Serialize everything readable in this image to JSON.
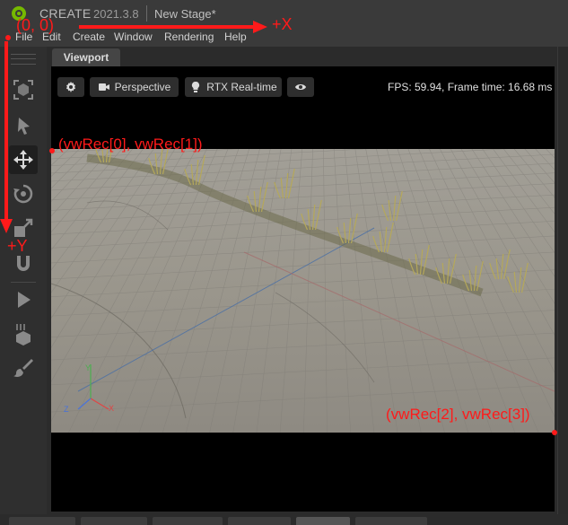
{
  "titlebar": {
    "app_name": "CREATE",
    "version": "2021.3.8",
    "stage": "New Stage*"
  },
  "menu": [
    "File",
    "Edit",
    "Create",
    "Window",
    "Rendering",
    "Help"
  ],
  "toolbar": {
    "tools": [
      "camera-frame-icon",
      "select-arrow-icon",
      "move-icon",
      "rotate-icon",
      "scale-icon",
      "snap-magnet-icon",
      "play-icon",
      "drop-to-ground-icon",
      "paint-brush-icon"
    ],
    "active_tool": "move-icon"
  },
  "panel": {
    "tab_label": "Viewport"
  },
  "viewport": {
    "settings_icon": "gear-icon",
    "camera_label": "Perspective",
    "renderer_label": "RTX Real-time",
    "visibility_icon": "eye-icon",
    "fps_text": "FPS: 59.94, Frame time: 16.68 ms"
  },
  "annotations": {
    "origin": "(0, 0)",
    "x_axis": "+X",
    "y_axis": "+Y",
    "top_left": "(vwRec[0], vwRec[1])",
    "bottom_right": "(vwRec[2], vwRec[3])",
    "color": "#ff1a1a"
  }
}
